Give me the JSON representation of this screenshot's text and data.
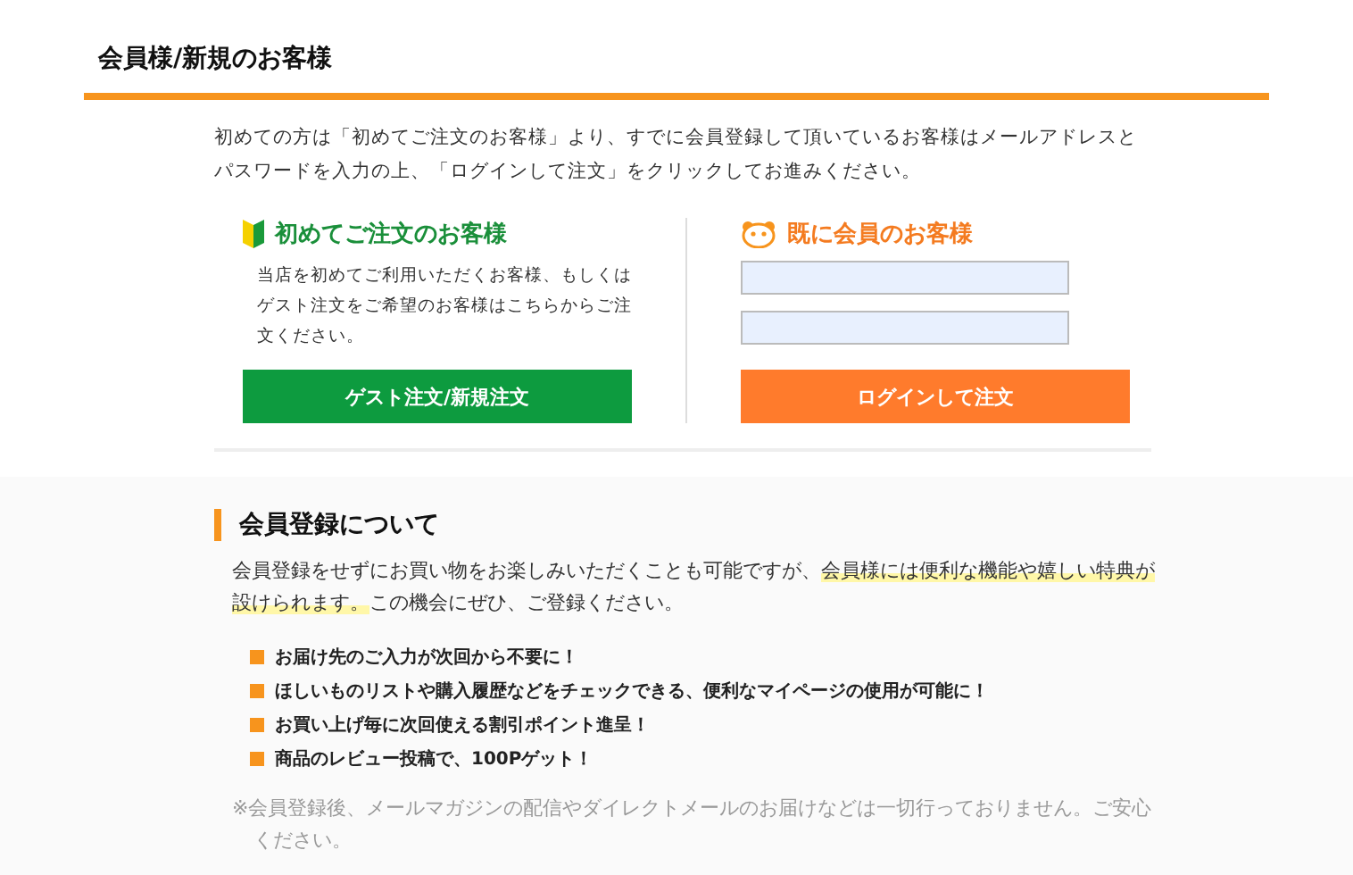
{
  "header": {
    "title": "会員様/新規のお客様"
  },
  "intro": "初めての方は「初めてご注文のお客様」より、すでに会員登録して頂いているお客様はメールアドレスとパスワードを入力の上、「ログインして注文」をクリックしてお進みください。",
  "guest": {
    "title": "初めてご注文のお客様",
    "text": "当店を初めてご利用いただくお客様、もしくはゲスト注文をご希望のお客様はこちらからご注文ください。",
    "button": "ゲスト注文/新規注文"
  },
  "member": {
    "title": "既に会員のお客様",
    "button": "ログインして注文"
  },
  "about": {
    "title": "会員登録について",
    "paragraph": [
      {
        "text": "会員登録をせずにお買い物をお楽しみいただくことも可能ですが、",
        "highlight": false
      },
      {
        "text": "会員様には便利な機能や嬉しい特典が設けられます。",
        "highlight": true
      },
      {
        "text": "この機会にぜひ、ご登録ください。",
        "highlight": false
      }
    ],
    "benefits": [
      "お届け先のご入力が次回から不要に！",
      "ほしいものリストや購入履歴などをチェックできる、便利なマイページの使用が可能に！",
      "お買い上げ毎に次回使える割引ポイント進呈！",
      "商品のレビュー投稿で、100Pゲット！"
    ],
    "note": "※会員登録後、メールマガジンの配信やダイレクトメールのお届けなどは一切行っておりません。ご安心ください。"
  }
}
